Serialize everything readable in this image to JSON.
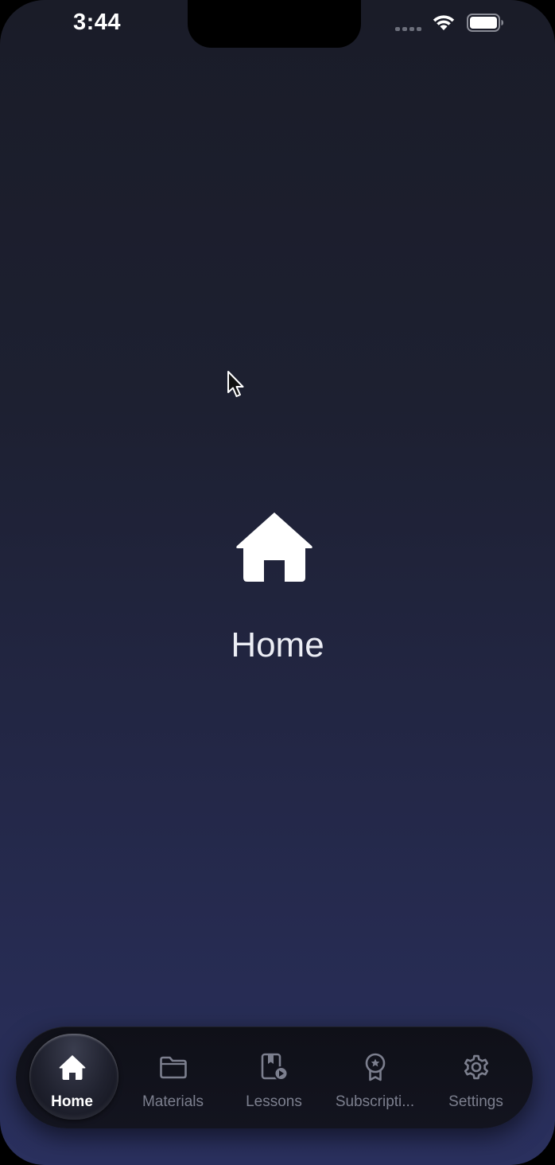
{
  "status_bar": {
    "time": "3:44",
    "icons": [
      "cellular-signal-icon",
      "wifi-icon",
      "battery-icon"
    ]
  },
  "main": {
    "icon": "house-icon",
    "title": "Home"
  },
  "tab_bar": {
    "active_index": 0,
    "tabs": [
      {
        "label": "Home",
        "icon": "house-icon"
      },
      {
        "label": "Materials",
        "icon": "folder-icon"
      },
      {
        "label": "Lessons",
        "icon": "lesson-video-icon"
      },
      {
        "label": "Subscripti...",
        "icon": "award-badge-icon"
      },
      {
        "label": "Settings",
        "icon": "gear-icon"
      }
    ]
  },
  "colors": {
    "background_top": "#1a1c28",
    "background_bottom": "#2a305e",
    "active_label": "#ffffff",
    "inactive_label": "#7c7f8e"
  }
}
